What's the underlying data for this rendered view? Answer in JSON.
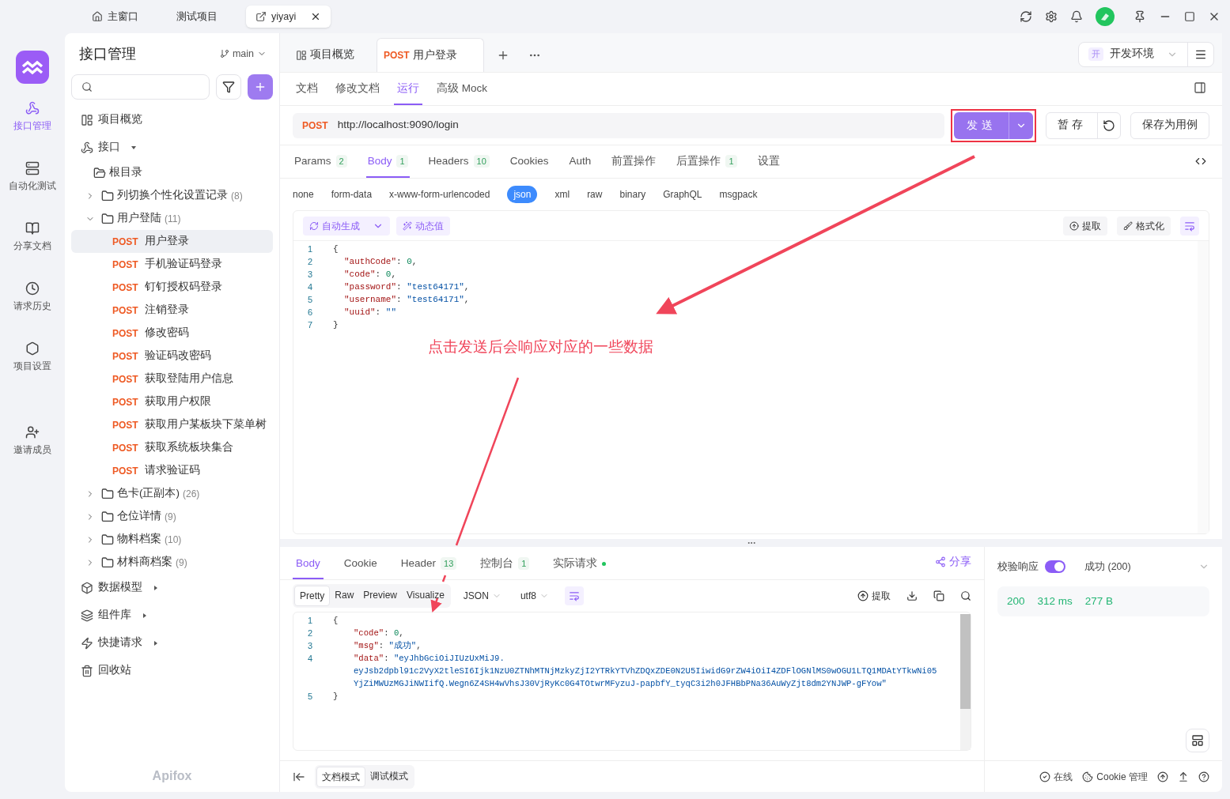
{
  "window_tabs": [
    {
      "label": "主窗口",
      "selected": false
    },
    {
      "label": "测试项目",
      "selected": false
    },
    {
      "label": "yiyayi",
      "selected": true
    }
  ],
  "rail": [
    {
      "label": "接口管理",
      "selected": true
    },
    {
      "label": "自动化测试",
      "selected": false
    },
    {
      "label": "分享文档",
      "selected": false
    },
    {
      "label": "请求历史",
      "selected": false
    },
    {
      "label": "项目设置",
      "selected": false
    },
    {
      "label": "邀请成员",
      "selected": false
    }
  ],
  "sidebar": {
    "title": "接口管理",
    "branch": "main",
    "brand": "Apifox",
    "tree": [
      {
        "kind": "link",
        "label": "项目概览"
      },
      {
        "kind": "section",
        "label": "接口",
        "expanded": true,
        "children": [
          {
            "kind": "root",
            "label": "根目录"
          },
          {
            "kind": "folder",
            "label": "列切换个性化设置记录",
            "count": "(8)",
            "expanded": false
          },
          {
            "kind": "folder",
            "label": "用户登陆",
            "count": "(11)",
            "expanded": true,
            "children": [
              {
                "kind": "endpoint",
                "method": "POST",
                "label": "用户登录",
                "selected": true
              },
              {
                "kind": "endpoint",
                "method": "POST",
                "label": "手机验证码登录",
                "selected": false
              },
              {
                "kind": "endpoint",
                "method": "POST",
                "label": "钉钉授权码登录",
                "selected": false
              },
              {
                "kind": "endpoint",
                "method": "POST",
                "label": "注销登录",
                "selected": false
              },
              {
                "kind": "endpoint",
                "method": "POST",
                "label": "修改密码",
                "selected": false
              },
              {
                "kind": "endpoint",
                "method": "POST",
                "label": "验证码改密码",
                "selected": false
              },
              {
                "kind": "endpoint",
                "method": "POST",
                "label": "获取登陆用户信息",
                "selected": false
              },
              {
                "kind": "endpoint",
                "method": "POST",
                "label": "获取用户权限",
                "selected": false
              },
              {
                "kind": "endpoint",
                "method": "POST",
                "label": "获取用户某板块下菜单树",
                "selected": false
              },
              {
                "kind": "endpoint",
                "method": "POST",
                "label": "获取系统板块集合",
                "selected": false
              },
              {
                "kind": "endpoint",
                "method": "POST",
                "label": "请求验证码",
                "selected": false
              }
            ]
          },
          {
            "kind": "folder",
            "label": "色卡(正副本)",
            "count": "(26)",
            "expanded": false
          },
          {
            "kind": "folder",
            "label": "仓位详情",
            "count": "(9)",
            "expanded": false
          },
          {
            "kind": "folder",
            "label": "物料档案",
            "count": "(10)",
            "expanded": false
          },
          {
            "kind": "folder",
            "label": "材料商档案",
            "count": "(9)",
            "expanded": false
          }
        ]
      },
      {
        "kind": "section",
        "label": "数据模型",
        "expanded": false
      },
      {
        "kind": "section",
        "label": "组件库",
        "expanded": false
      },
      {
        "kind": "section",
        "label": "快捷请求",
        "expanded": false
      },
      {
        "kind": "link",
        "label": "回收站"
      }
    ]
  },
  "doc_tabs": [
    {
      "label": "项目概览",
      "selected": false
    },
    {
      "method": "POST",
      "label": "用户登录",
      "selected": true
    }
  ],
  "environment": {
    "badge": "开",
    "name": "开发环境"
  },
  "view_tabs": [
    {
      "label": "文档",
      "selected": false
    },
    {
      "label": "修改文档",
      "selected": false
    },
    {
      "label": "运行",
      "selected": true
    },
    {
      "label": "高级 Mock",
      "selected": false
    }
  ],
  "request": {
    "method": "POST",
    "url": "http://localhost:9090/login",
    "send": "发送",
    "save": "暂存",
    "save_case": "保存为用例"
  },
  "param_tabs": [
    {
      "label": "Params",
      "count": "2",
      "selected": false
    },
    {
      "label": "Body",
      "count": "1",
      "selected": true
    },
    {
      "label": "Headers",
      "count": "10",
      "selected": false
    },
    {
      "label": "Cookies",
      "selected": false
    },
    {
      "label": "Auth",
      "selected": false
    },
    {
      "label": "前置操作",
      "selected": false
    },
    {
      "label": "后置操作",
      "count": "1",
      "selected": false
    },
    {
      "label": "设置",
      "selected": false
    }
  ],
  "body_types": [
    {
      "label": "none",
      "selected": false
    },
    {
      "label": "form-data",
      "selected": false
    },
    {
      "label": "x-www-form-urlencoded",
      "selected": false
    },
    {
      "label": "json",
      "selected": true
    },
    {
      "label": "xml",
      "selected": false
    },
    {
      "label": "raw",
      "selected": false
    },
    {
      "label": "binary",
      "selected": false
    },
    {
      "label": "GraphQL",
      "selected": false
    },
    {
      "label": "msgpack",
      "selected": false
    }
  ],
  "editor_tools": {
    "auto": "自动生成",
    "dynamic": "动态值",
    "extract": "提取",
    "format": "格式化"
  },
  "request_body": [
    {
      "no": "1",
      "tokens": [
        {
          "text": "{",
          "kind": "punct"
        }
      ]
    },
    {
      "no": "2",
      "tokens": [
        {
          "text": "\"authCode\"",
          "kind": "key"
        },
        {
          "text": ": ",
          "kind": "punct"
        },
        {
          "text": "0",
          "kind": "number"
        },
        {
          "text": ",",
          "kind": "punct"
        }
      ]
    },
    {
      "no": "3",
      "tokens": [
        {
          "text": "\"code\"",
          "kind": "key"
        },
        {
          "text": ": ",
          "kind": "punct"
        },
        {
          "text": "0",
          "kind": "number"
        },
        {
          "text": ",",
          "kind": "punct"
        }
      ]
    },
    {
      "no": "4",
      "tokens": [
        {
          "text": "\"password\"",
          "kind": "key"
        },
        {
          "text": ": ",
          "kind": "punct"
        },
        {
          "text": "\"test64171\"",
          "kind": "string"
        },
        {
          "text": ",",
          "kind": "punct"
        }
      ]
    },
    {
      "no": "5",
      "tokens": [
        {
          "text": "\"username\"",
          "kind": "key"
        },
        {
          "text": ": ",
          "kind": "punct"
        },
        {
          "text": "\"test64171\"",
          "kind": "string"
        },
        {
          "text": ",",
          "kind": "punct"
        }
      ]
    },
    {
      "no": "6",
      "tokens": [
        {
          "text": "\"uuid\"",
          "kind": "key"
        },
        {
          "text": ": ",
          "kind": "punct"
        },
        {
          "text": "\"\"",
          "kind": "string"
        }
      ]
    },
    {
      "no": "7",
      "tokens": [
        {
          "text": "}",
          "kind": "punct"
        }
      ]
    }
  ],
  "annotation": {
    "text": "点击发送后会响应对应的一些数据"
  },
  "response_tabs": [
    {
      "label": "Body",
      "selected": true
    },
    {
      "label": "Cookie",
      "selected": false
    },
    {
      "label": "Header",
      "count": "13",
      "selected": false
    },
    {
      "label": "控制台",
      "count": "1",
      "selected": false
    },
    {
      "label": "实际请求",
      "dot": true,
      "selected": false
    }
  ],
  "share": "分享",
  "view_modes": [
    {
      "label": "Pretty",
      "selected": true
    },
    {
      "label": "Raw",
      "selected": false
    },
    {
      "label": "Preview",
      "selected": false
    },
    {
      "label": "Visualize",
      "selected": false
    }
  ],
  "format": "JSON",
  "encoding": "utf8",
  "extract": "提取",
  "response_body": [
    {
      "no": "1",
      "tokens": [
        {
          "text": "{",
          "kind": "punct"
        }
      ]
    },
    {
      "no": "2",
      "tokens": [
        {
          "text": "\"code\"",
          "kind": "key"
        },
        {
          "text": ": ",
          "kind": "punct"
        },
        {
          "text": "0",
          "kind": "number"
        },
        {
          "text": ",",
          "kind": "punct"
        }
      ]
    },
    {
      "no": "3",
      "tokens": [
        {
          "text": "\"msg\"",
          "kind": "key"
        },
        {
          "text": ": ",
          "kind": "punct"
        },
        {
          "text": "\"成功\"",
          "kind": "string"
        },
        {
          "text": ",",
          "kind": "punct"
        }
      ]
    },
    {
      "no": "4",
      "tokens": [
        {
          "text": "\"data\"",
          "kind": "key"
        },
        {
          "text": ": ",
          "kind": "punct"
        },
        {
          "text": "\"eyJhbGciOiJIUzUxMiJ9.",
          "kind": "string"
        }
      ]
    },
    {
      "tokens": [
        {
          "text": "eyJsb2dpbl91c2VyX2tleSI6Ijk1NzU0ZTNhMTNjMzkyZjI2YTRkYTVhZDQxZDE0N2U5IiwidG9rZW4iOiI4ZDFlOGNlMS0wOGU1LTQ1MDAtYTkwNi05",
          "kind": "string"
        }
      ]
    },
    {
      "tokens": [
        {
          "text": "YjZiMWUzMGJiNWIifQ.Wegn6Z4SH4wVhsJ30VjRyKc0G4TOtwrMFyzuJ-papbfY_tyqC3i2h0JFHBbPNa36AuWyZjt8dm2YNJWP-gFYow\"",
          "kind": "string"
        }
      ]
    },
    {
      "no": "5",
      "tokens": [
        {
          "text": "}",
          "kind": "punct"
        }
      ]
    }
  ],
  "validation": {
    "label": "校验响应",
    "on": true,
    "result": "成功 (200)"
  },
  "stats": [
    "200",
    "312 ms",
    "277 B"
  ],
  "modes": [
    {
      "label": "文档模式",
      "selected": true
    },
    {
      "label": "调试模式",
      "selected": false
    }
  ],
  "status_items": [
    {
      "label": "在线"
    },
    {
      "label": "Cookie 管理"
    }
  ]
}
